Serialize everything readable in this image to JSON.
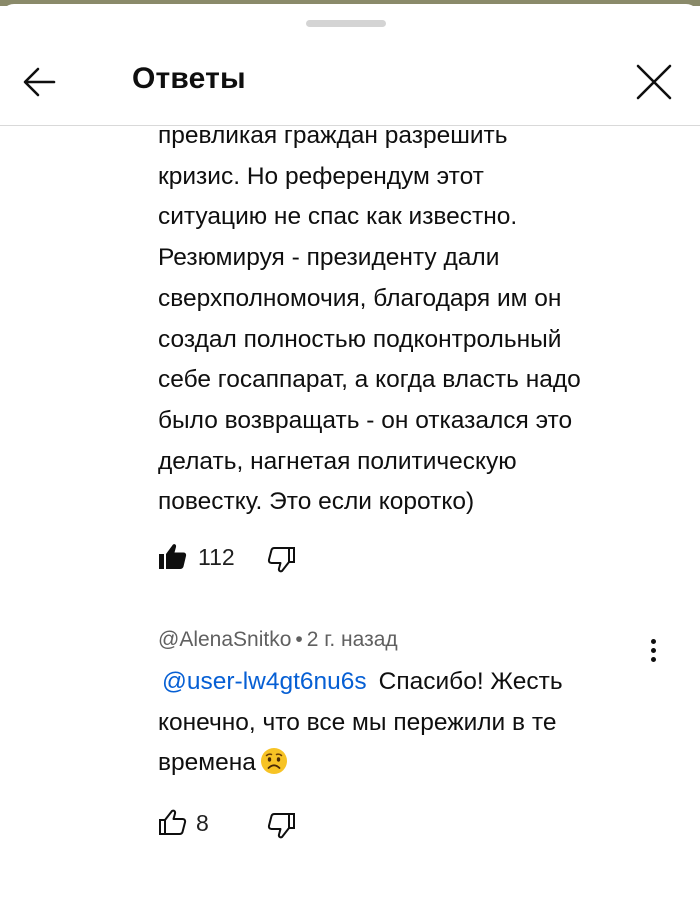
{
  "header": {
    "title": "Ответы",
    "back_icon": "arrow-left-icon",
    "close_icon": "close-icon"
  },
  "reply_1": {
    "lines": [
      "превликая граждан разрешить",
      "кризис. Но референдум этот",
      "ситуацию не спас как известно.",
      "Резюмируя - президенту дали",
      "сверхполномочия, благодаря им он",
      "создал полностью подконтрольный",
      "себе госаппарат, а когда власть надо",
      "было возвращать - он отказался это",
      "делать, нагнетая политическую",
      "повестку. Это если коротко)"
    ],
    "likes": "112",
    "liked": true
  },
  "reply_2": {
    "author": "@AlenaSnitko",
    "time": "2 г. назад",
    "mention": "@user-lw4gt6nu6s",
    "lines": [
      "Спасибо! Жесть",
      "конечно, что все мы пережили в те",
      "времена"
    ],
    "emoji": "worried-face-emoji",
    "likes": "8",
    "liked": false
  },
  "colors": {
    "link": "#065fd4",
    "text": "#0f0f0f",
    "secondary": "#606060",
    "divider": "#d9d9d9"
  }
}
